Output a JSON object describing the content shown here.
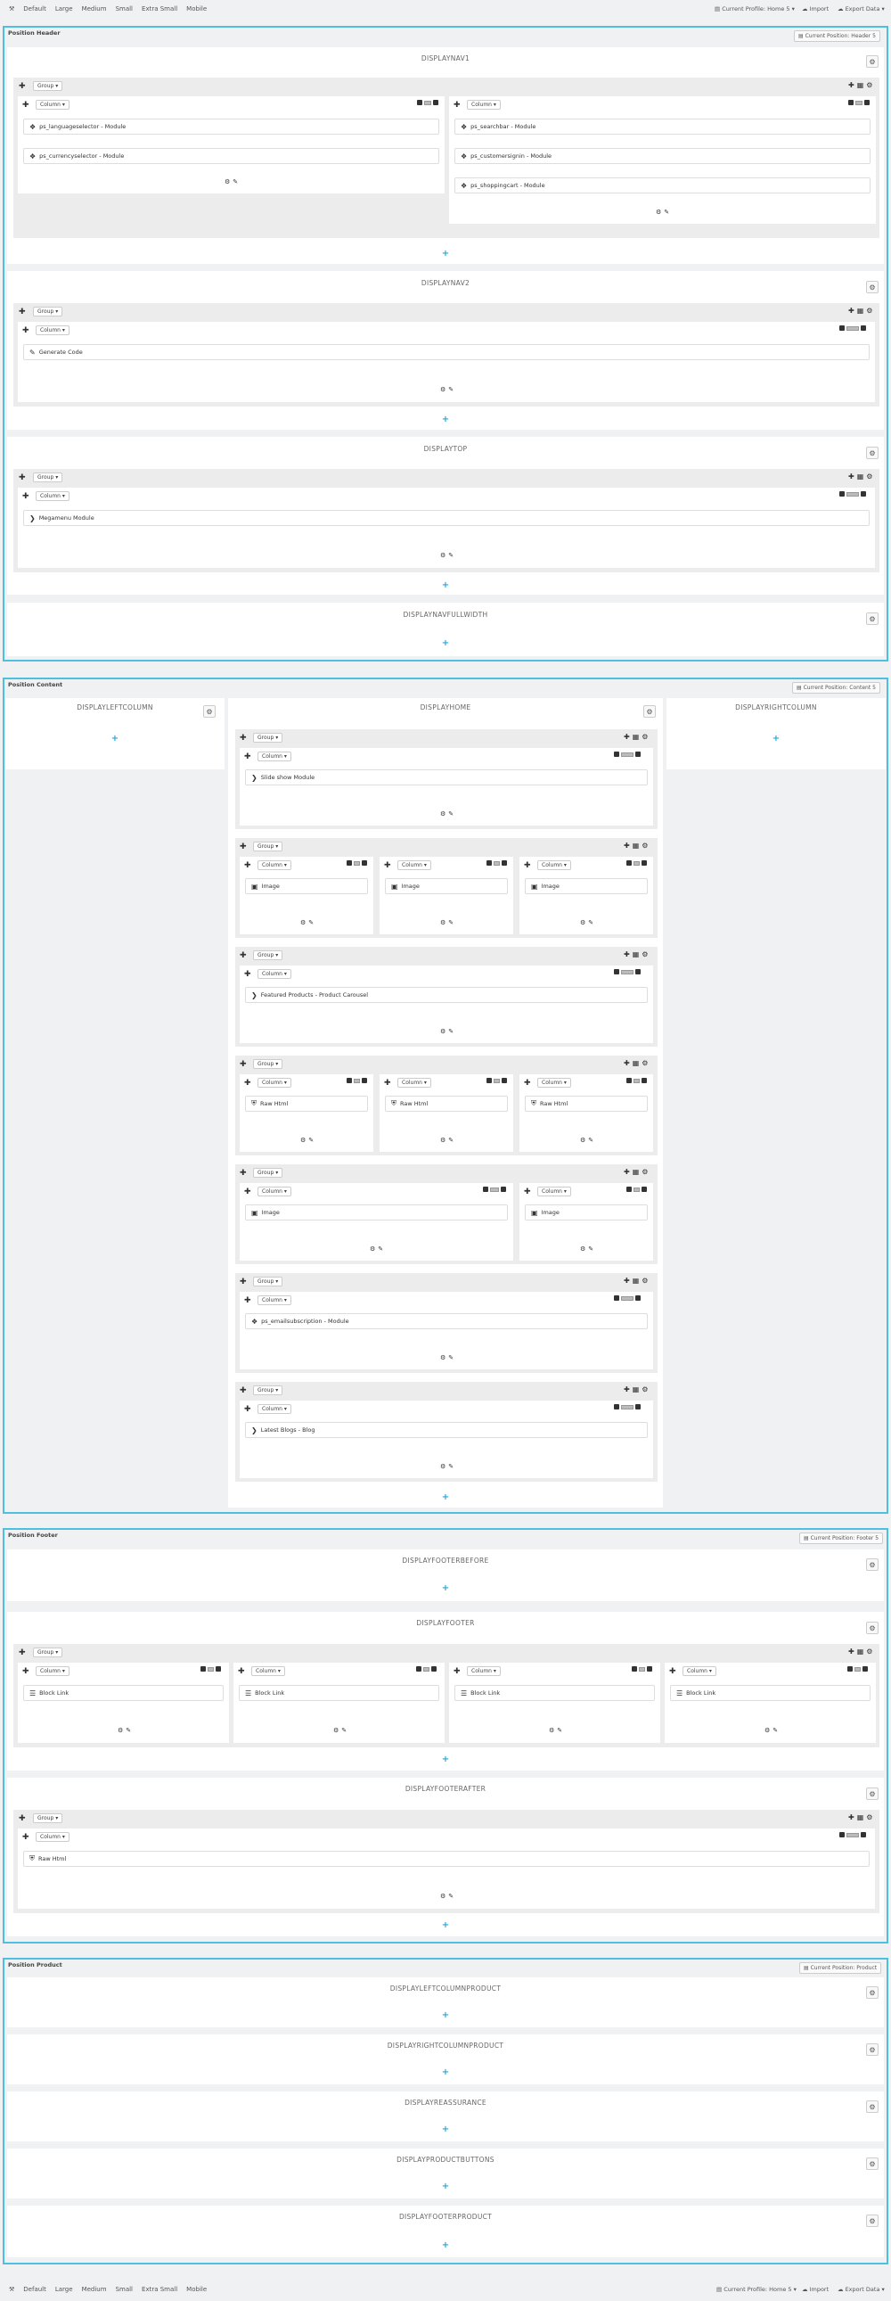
{
  "toolbar": {
    "sizes": [
      "Default",
      "Large",
      "Medium",
      "Small",
      "Extra Small",
      "Mobile"
    ],
    "profile": "Current Profile: Home 5",
    "import": "Import",
    "export": "Export Data"
  },
  "labels": {
    "group": "Group",
    "column": "Column"
  },
  "positions": {
    "header": {
      "title": "Position Header",
      "current": "Current Position: Header 5"
    },
    "content": {
      "title": "Position Content",
      "current": "Current Position: Content 5"
    },
    "footer": {
      "title": "Position Footer",
      "current": "Current Position: Footer 5"
    },
    "product": {
      "title": "Position Product",
      "current": "Current Position: Product"
    }
  },
  "hooks": {
    "displaynav1": "DISPLAYNAV1",
    "displaynav2": "DISPLAYNAV2",
    "displaytop": "DISPLAYTOP",
    "displaynavfullwidth": "DISPLAYNAVFULLWIDTH",
    "displayleftcolumn": "DISPLAYLEFTCOLUMN",
    "displayhome": "DISPLAYHOME",
    "displayrightcolumn": "DISPLAYRIGHTCOLUMN",
    "displayfooterbefore": "DISPLAYFOOTERBEFORE",
    "displayfooter": "DISPLAYFOOTER",
    "displayfooterafter": "DISPLAYFOOTERAFTER",
    "displayleftcolumnproduct": "DISPLAYLEFTCOLUMNPRODUCT",
    "displayrightcolumnproduct": "DISPLAYRIGHTCOLUMNPRODUCT",
    "displayreassurance": "DISPLAYREASSURANCE",
    "displayproductbuttons": "DISPLAYPRODUCTBUTTONS",
    "displayfooterproduct": "DISPLAYFOOTERPRODUCT"
  },
  "widgets": {
    "languageselector": "ps_languageselector - Module",
    "currencyselector": "ps_currencyselector - Module",
    "searchbar": "ps_searchbar - Module",
    "customersignin": "ps_customersignin - Module",
    "shoppingcart": "ps_shoppingcart - Module",
    "generatecode": "Generate Code",
    "megamenu": "Megamenu Module",
    "slideshow": "Slide show Module",
    "image": "Image",
    "featured": "Featured Products - Product Carousel",
    "rawhtml": "Raw Html",
    "emailsubscription": "ps_emailsubscription - Module",
    "latestblogs": "Latest Blogs - Blog",
    "blocklink": "Block Link"
  }
}
